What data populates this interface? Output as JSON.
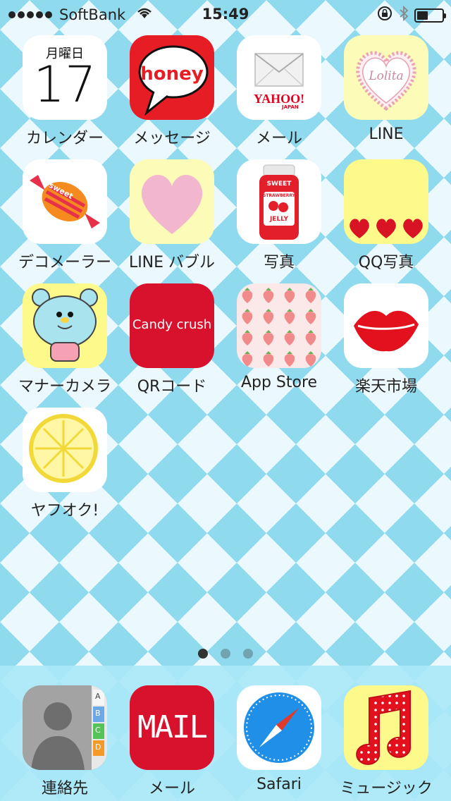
{
  "status": {
    "carrier": "SoftBank",
    "time": "15:49",
    "battery_level": 0.45
  },
  "apps": [
    {
      "label": "カレンダー",
      "calendar_weekday": "月曜日",
      "calendar_day": "17"
    },
    {
      "label": "メッセージ",
      "text": "honey"
    },
    {
      "label": "メール",
      "brand": "YAHOO!",
      "brand_sub": "JAPAN"
    },
    {
      "label": "LINE",
      "text": "Lolita"
    },
    {
      "label": "デコメーラー",
      "text": "sweet"
    },
    {
      "label": "LINE バブル"
    },
    {
      "label": "写真",
      "jar_top": "SWEET",
      "jar_mid": "STRAWBERRY",
      "jar_bottom": "JELLY"
    },
    {
      "label": "QQ写真"
    },
    {
      "label": "マナーカメラ"
    },
    {
      "label": "QRコード",
      "text": "Candy crush"
    },
    {
      "label": "App Store"
    },
    {
      "label": "楽天市場"
    },
    {
      "label": "ヤフオク!"
    }
  ],
  "dock": [
    {
      "label": "連絡先",
      "tabs": [
        "A",
        "B",
        "C",
        "D"
      ]
    },
    {
      "label": "メール",
      "text": "MAIL"
    },
    {
      "label": "Safari"
    },
    {
      "label": "ミュージック"
    }
  ],
  "colors": {
    "accent_red": "#e0102b",
    "pale_yellow": "#fdfbb8",
    "dock_bg": "#aae8f8"
  }
}
